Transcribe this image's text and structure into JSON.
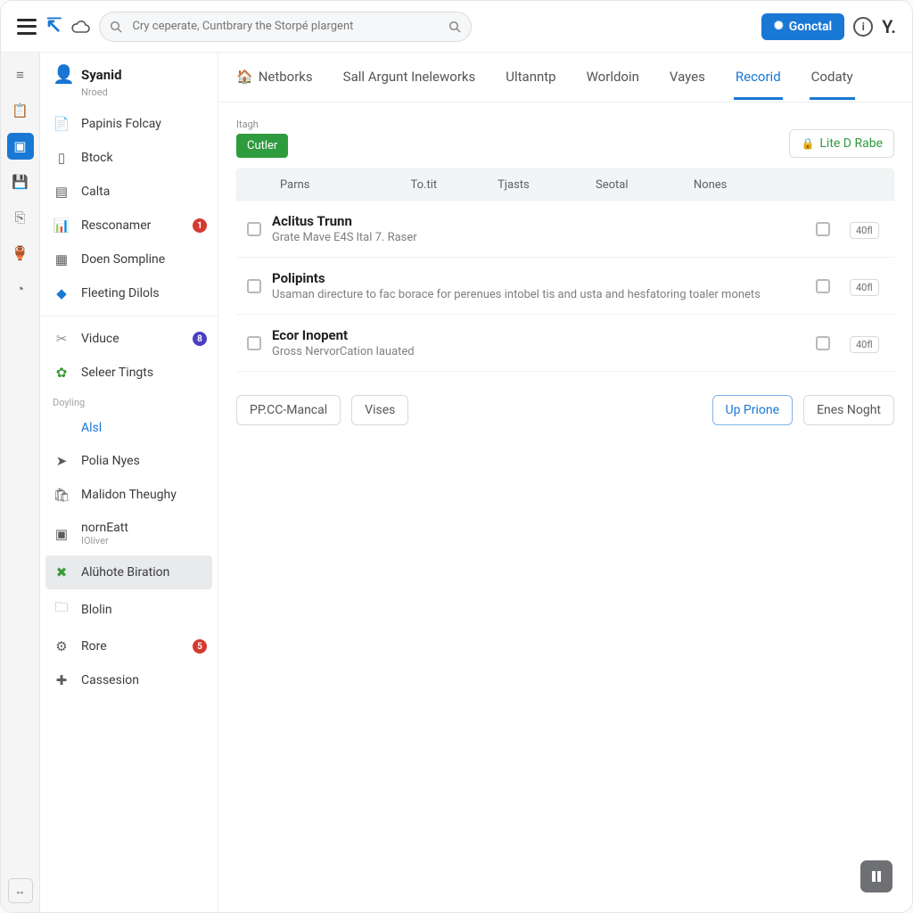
{
  "topbar": {
    "search_placeholder": "Cry ceperate, Cuntbrary the Storpé plargent",
    "primary_button": "Gonctal"
  },
  "rail": {
    "items": [
      "menu",
      "clipboard",
      "panel-active",
      "save",
      "box",
      "jar",
      "clock"
    ],
    "collapse_label": "↔"
  },
  "sidebar": {
    "user": {
      "name": "Syanid",
      "status": "Nroed"
    },
    "group1": [
      {
        "icon": "doc",
        "label": "Papinis Folcay"
      },
      {
        "icon": "one",
        "label": "Btock"
      },
      {
        "icon": "calc",
        "label": "Calta"
      },
      {
        "icon": "chart",
        "label": "Resconamer",
        "badge": "1",
        "badge_color": "red"
      },
      {
        "icon": "grid",
        "label": "Doen Sompline"
      },
      {
        "icon": "bolt",
        "label": "Fleeting Dilols"
      }
    ],
    "group2": [
      {
        "icon": "tools",
        "label": "Viduce",
        "badge": "8",
        "badge_color": "purple"
      },
      {
        "icon": "gear-g",
        "label": "Seleer Tingts"
      }
    ],
    "section_label": "Doyling",
    "group3": [
      {
        "icon": "pill",
        "label": "Alsl",
        "link": true
      },
      {
        "icon": "send",
        "label": "Polia Nyes"
      },
      {
        "icon": "bag",
        "label": "Malidon Theughy"
      },
      {
        "icon": "cal",
        "label": "nornEatt",
        "sub": "IOliver"
      },
      {
        "icon": "wrench",
        "label": "Alühote Biration",
        "selected": true
      },
      {
        "icon": "folder",
        "label": "Blolin"
      },
      {
        "icon": "cog",
        "label": "Rore",
        "badge": "5",
        "badge_color": "red2"
      },
      {
        "icon": "med",
        "label": "Cassesion"
      }
    ]
  },
  "tabs": [
    {
      "label": "Netborks",
      "home": true
    },
    {
      "label": "Sall Argunt Ineleworks"
    },
    {
      "label": "Ultanntp"
    },
    {
      "label": "Worldoin"
    },
    {
      "label": "Vayes"
    },
    {
      "label": "Recorid",
      "active": true
    },
    {
      "label": "Codaty",
      "semi": true
    }
  ],
  "toolbar": {
    "mini_label": "Itagh",
    "green_button": "Cutler",
    "live_button": "Lite D Rabe"
  },
  "columns": [
    "Parns",
    "To.tit",
    "Tjasts",
    "Seotal",
    "Nones"
  ],
  "rows": [
    {
      "title": "Aclitus Trunn",
      "desc": "Grate Mave E4S ltal 7. Raser",
      "chip": "40fl"
    },
    {
      "title": "Polipints",
      "desc": "Usaman directure to fac borace for perenues intobel tis and usta and hesfatoring toaler monets",
      "chip": "40fl"
    },
    {
      "title": "Ecor Inopent",
      "desc": "Gross NervorCation lauated",
      "chip": "40fl"
    }
  ],
  "footer": {
    "btn1": "PP.CC-Mancal",
    "btn2": "Vises",
    "btn_primary": "Up Prione",
    "btn_last": "Enes Noght"
  },
  "float_icon": "pause"
}
